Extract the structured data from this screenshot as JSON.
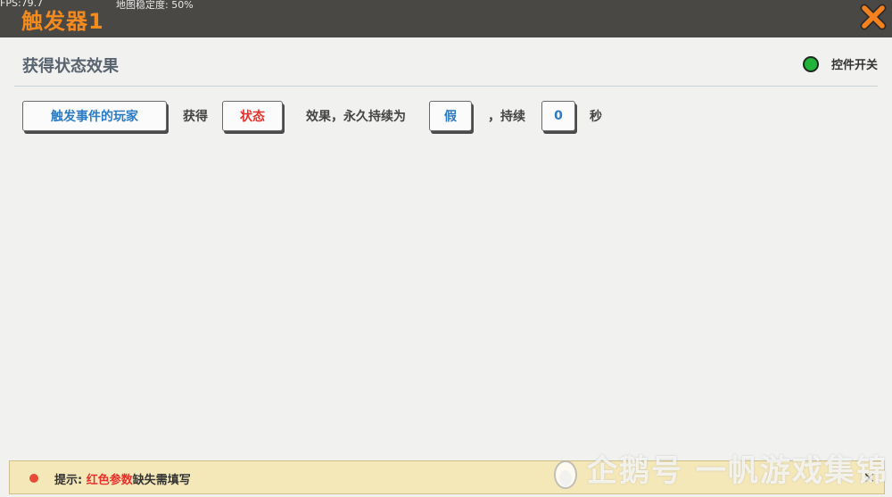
{
  "titlebar": {
    "fps": "FPS:79.7",
    "map_stability": "地图稳定度: 50%",
    "title": "触发器1",
    "close_icon": "close-x-icon",
    "title_color": "#f28a1e"
  },
  "panel": {
    "section_title": "获得状态效果",
    "switch_label": "控件开关",
    "switch_on_color": "#22b43a"
  },
  "rule": {
    "player_chip": "触发事件的玩家",
    "text_gain": "获得",
    "state_chip": "状态",
    "text_effect_permanent": "效果，永久持续为",
    "bool_chip": "假",
    "text_duration": "，持续",
    "number_chip": "0",
    "text_seconds": "秒"
  },
  "hint": {
    "prefix": "提示: ",
    "red_part": "红色参数",
    "suffix": "缺失需填写",
    "close": "✕"
  },
  "watermark": "企鹅号 一帆游戏集锦"
}
